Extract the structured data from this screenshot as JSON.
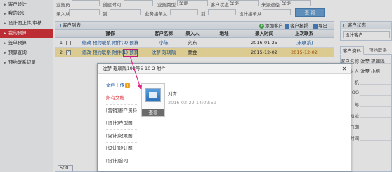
{
  "sidebar": {
    "items": [
      {
        "label": "客户设计",
        "active": false
      },
      {
        "label": "我的设计",
        "active": false
      },
      {
        "label": "设计图上传/审核",
        "active": false
      },
      {
        "label": "我的预算",
        "active": true
      },
      {
        "label": "签单预算",
        "active": false
      },
      {
        "label": "预算查询",
        "active": false
      },
      {
        "label": "预约联系记录",
        "active": false
      }
    ]
  },
  "filter": {
    "labels": [
      "业务员",
      "创建时间",
      "业务类型",
      "客户状态",
      "来源途径",
      "录入从",
      "到",
      "业务接单从",
      "到",
      "设计接单从"
    ],
    "values": [
      "",
      "",
      "全部",
      "全部",
      "全部",
      "",
      "",
      "",
      "",
      ""
    ],
    "query_label": "查 询"
  },
  "customer_list": {
    "title": "客户列表",
    "toolbar": [
      "添加客户",
      "客户报损",
      "导出"
    ],
    "columns": [
      "",
      "",
      "操作",
      "客户名称",
      "录入人",
      "地址",
      "录入时间",
      "上次联系"
    ],
    "rows": [
      {
        "num": "1",
        "checked": false,
        "ops": "修改 预约联系 附件(2) 预算",
        "name": "小陈",
        "entered_by": "刘东",
        "address": "",
        "created": "2016-01-25",
        "last": "[未联系]"
      },
      {
        "num": "2",
        "checked": true,
        "ops": "修改 预约联系 附件(1) 预算",
        "name": "沈梦 琨璃隔",
        "entered_by": "蒙金",
        "address": "",
        "created": "2015-12-02",
        "last": "2015-12-02"
      }
    ],
    "page_size": "500"
  },
  "right_panel": {
    "status_title": "客户状态",
    "status_value": "设计客户",
    "tabs": [
      "客户资料",
      "预约联系"
    ],
    "fields": [
      {
        "label": "客户名称",
        "value": "沈梦 琨璃隔"
      },
      {
        "label": "联 系 人",
        "value": "沈梦 小姐"
      },
      {
        "label": "机",
        "value": ""
      },
      {
        "label": "QQ",
        "value": ""
      },
      {
        "label": "邮",
        "value": ""
      },
      {
        "label": "地址",
        "value": ""
      },
      {
        "label": "接单日期",
        "value": ""
      },
      {
        "label": "预约时间",
        "value": ""
      }
    ]
  },
  "modal": {
    "title": "沈梦 琨璃隔192号5-10-2 附件",
    "upload_label": "文档上传",
    "left_items": [
      "所有文档",
      "[营销]客户资料",
      "[设计]户型图",
      "[设计]效果图",
      "[设计]设计图",
      "[设计]合同"
    ],
    "file": {
      "name": "刘青",
      "date": "2016-02-22 14:02:59",
      "action_label": "查看"
    }
  },
  "colors": {
    "accent_red": "#d8343c",
    "link_blue": "#1f5fa8",
    "selected_row": "#fbe7a6",
    "arrow_pink": "#e0218a"
  }
}
